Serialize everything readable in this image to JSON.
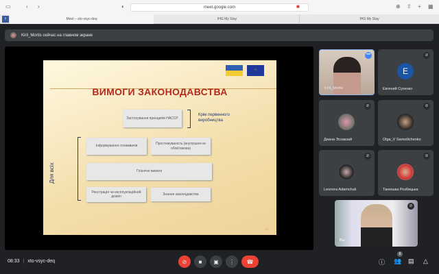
{
  "browser": {
    "url": "meet.google.com",
    "tabs": [
      "Meet – xto-vsyc-deq",
      "IHG My Stay",
      "IHG My Stay"
    ]
  },
  "banner": {
    "text": "Kiril_Mortis сейчас на главном экране"
  },
  "slide": {
    "title": "ВИМОГИ ЗАКОНОДАВСТВА",
    "haccp": "Застосування принципів НАССР",
    "haccp_note": "Крім первинного виробництва",
    "for_all": "Для всіх",
    "boxes": [
      "Інформування споживачів",
      "Простежуваність (внутрішня не обов'язкова)",
      "Гігієнічні вимоги",
      "Реєстрація чи експлуатаційний дозвіл",
      "Знання законодавства"
    ],
    "page": "24"
  },
  "participants": [
    {
      "name": "Kiril_Mortis"
    },
    {
      "name": "Евгений Сухенко",
      "initial": "E"
    },
    {
      "name": "Диана Эсхакзай"
    },
    {
      "name": "Olga_V Samoilichenko"
    },
    {
      "name": "Leonora Adamchuk"
    },
    {
      "name": "Танюшка Розбицька"
    },
    {
      "name": "Вы"
    }
  ],
  "bottom": {
    "time": "08:33",
    "meeting_code": "xto-vsyc-deq",
    "participants_count": "8"
  },
  "colors": {
    "end_call": "#ea4335",
    "accent": "#8ab4f8"
  }
}
